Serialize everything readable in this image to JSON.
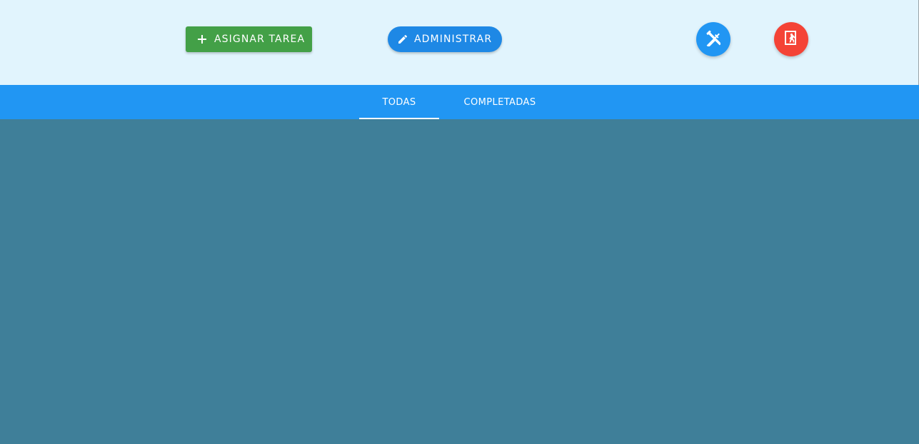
{
  "toolbar": {
    "assign_button": {
      "label": "ASIGNAR TAREA",
      "icon": "plus-icon",
      "color": "#43a047"
    },
    "admin_button": {
      "label": "ADMINISTRAR",
      "icon": "pencil-icon",
      "color": "#1e88e5"
    },
    "tools_button": {
      "icon": "tools-icon",
      "color": "#2196f3"
    },
    "exit_button": {
      "icon": "exit-door-icon",
      "color": "#f44336"
    }
  },
  "tabs": {
    "items": [
      {
        "label": "TODAS",
        "active": true
      },
      {
        "label": "COMPLETADAS",
        "active": false
      }
    ],
    "bar_color": "#2196f3"
  },
  "colors": {
    "header_background": "#e1f4fd",
    "content_background": "#3f7f99"
  }
}
